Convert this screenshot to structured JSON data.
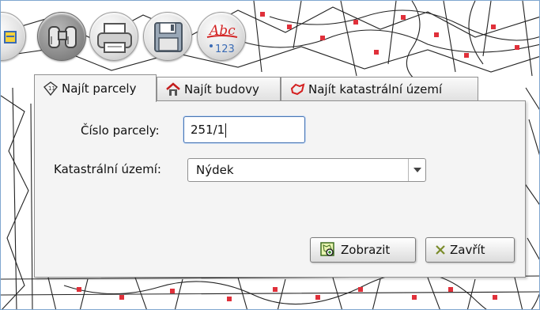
{
  "toolbar": {
    "tools": [
      {
        "icon": "legend-icon"
      },
      {
        "icon": "binoculars-icon"
      },
      {
        "icon": "printer-icon"
      },
      {
        "icon": "floppy-disk-icon"
      },
      {
        "icon": "spellcheck-icon",
        "text_top": "Abc",
        "text_bottom": "123"
      }
    ]
  },
  "tabs": [
    {
      "label": "Najít parcely",
      "icon": "parcel-icon",
      "active": true
    },
    {
      "label": "Najít budovy",
      "icon": "house-icon",
      "active": false
    },
    {
      "label": "Najít katastrální území",
      "icon": "territory-icon",
      "active": false
    }
  ],
  "form": {
    "parcel_number_label": "Číslo parcely:",
    "parcel_number_value": "251/1",
    "territory_label": "Katastrální území:",
    "territory_value": "Nýdek"
  },
  "buttons": {
    "show_label": "Zobrazit",
    "show_icon": "zoom-to-icon",
    "close_label": "Zavřít",
    "close_icon": "close-x-icon"
  },
  "colors": {
    "accent": "#4a76b3",
    "map_line": "#222222",
    "map_marker": "#e0303a"
  }
}
